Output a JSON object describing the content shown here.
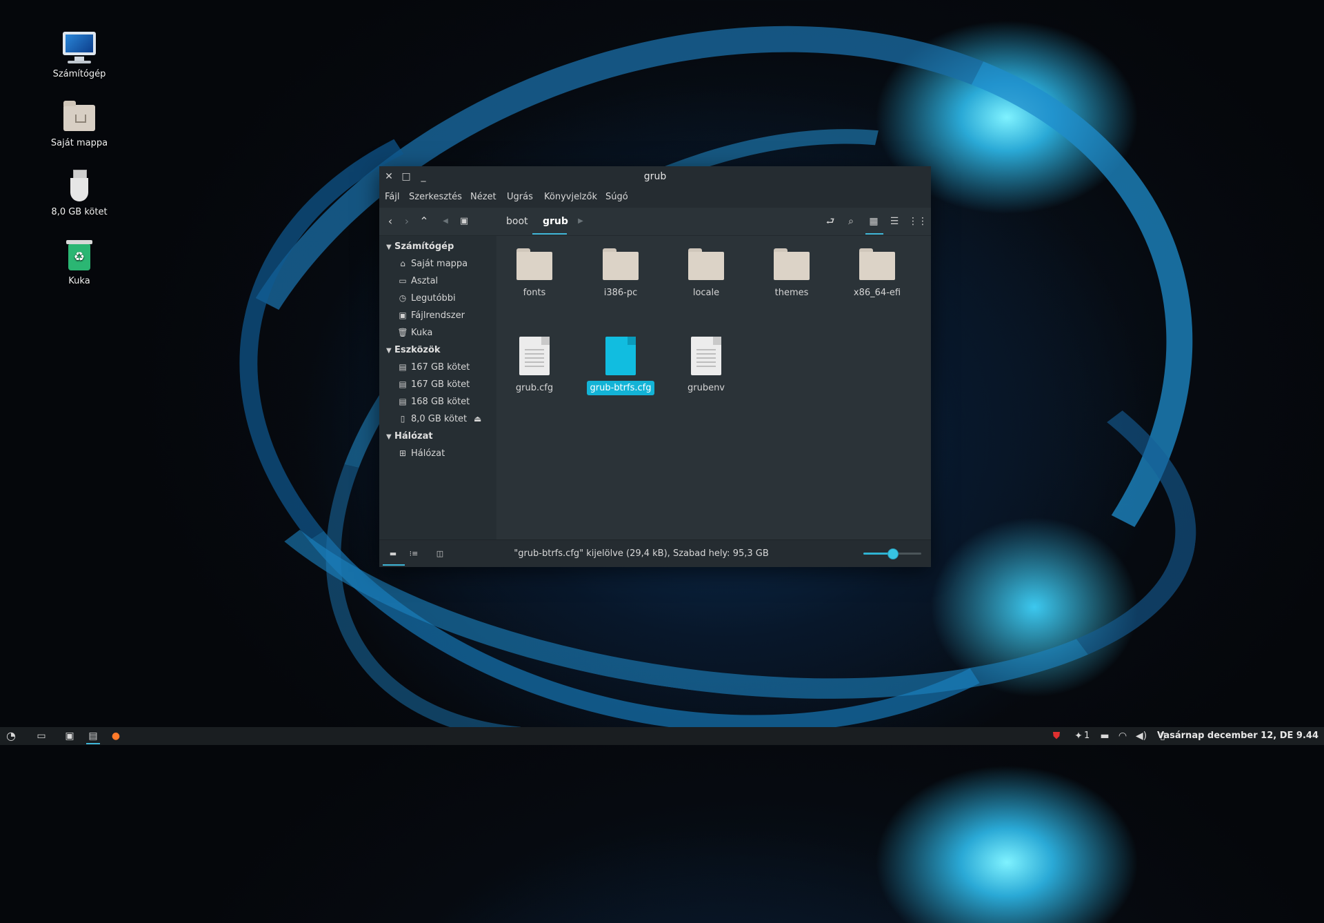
{
  "desktop": {
    "icons": [
      {
        "label": "Számítógép",
        "icon": "computer-icon"
      },
      {
        "label": "Saját mappa",
        "icon": "home-folder-icon"
      },
      {
        "label": "8,0 GB kötet",
        "icon": "usb-drive-icon"
      },
      {
        "label": "Kuka",
        "icon": "trash-icon"
      }
    ]
  },
  "window": {
    "title": "grub",
    "menu": [
      "Fájl",
      "Szerkesztés",
      "Nézet",
      "Ugrás",
      "Könyvjelzők",
      "Súgó"
    ],
    "breadcrumb": [
      "boot",
      "grub"
    ],
    "sidebar": {
      "sections": [
        {
          "title": "Számítógép",
          "items": [
            {
              "label": "Saját mappa",
              "icon": "home-icon"
            },
            {
              "label": "Asztal",
              "icon": "desktop-folder-icon"
            },
            {
              "label": "Legutóbbi",
              "icon": "clock-icon"
            },
            {
              "label": "Fájlrendszer",
              "icon": "filesystem-icon"
            },
            {
              "label": "Kuka",
              "icon": "trash-icon"
            }
          ]
        },
        {
          "title": "Eszközök",
          "items": [
            {
              "label": "167 GB kötet",
              "icon": "drive-icon"
            },
            {
              "label": "167 GB kötet",
              "icon": "drive-icon"
            },
            {
              "label": "168 GB kötet",
              "icon": "drive-icon"
            },
            {
              "label": "8,0 GB kötet",
              "icon": "usb-icon"
            }
          ]
        },
        {
          "title": "Hálózat",
          "items": [
            {
              "label": "Hálózat",
              "icon": "network-icon"
            }
          ]
        }
      ]
    },
    "files": [
      {
        "name": "fonts",
        "type": "folder"
      },
      {
        "name": "i386-pc",
        "type": "folder"
      },
      {
        "name": "locale",
        "type": "folder"
      },
      {
        "name": "themes",
        "type": "folder"
      },
      {
        "name": "x86_64-efi",
        "type": "folder"
      },
      {
        "name": "grub.cfg",
        "type": "file"
      },
      {
        "name": "grub-btrfs.cfg",
        "type": "file",
        "selected": true
      },
      {
        "name": "grubenv",
        "type": "file"
      }
    ],
    "status": "\"grub-btrfs.cfg\" kijelölve (29,4 kB), Szabad hely: 95,3 GB",
    "zoom_level": 0.5,
    "accent": "#13b3d6"
  },
  "taskbar": {
    "tray_count": "1",
    "clock": "Vasárnap december 12, DE 9.44"
  }
}
